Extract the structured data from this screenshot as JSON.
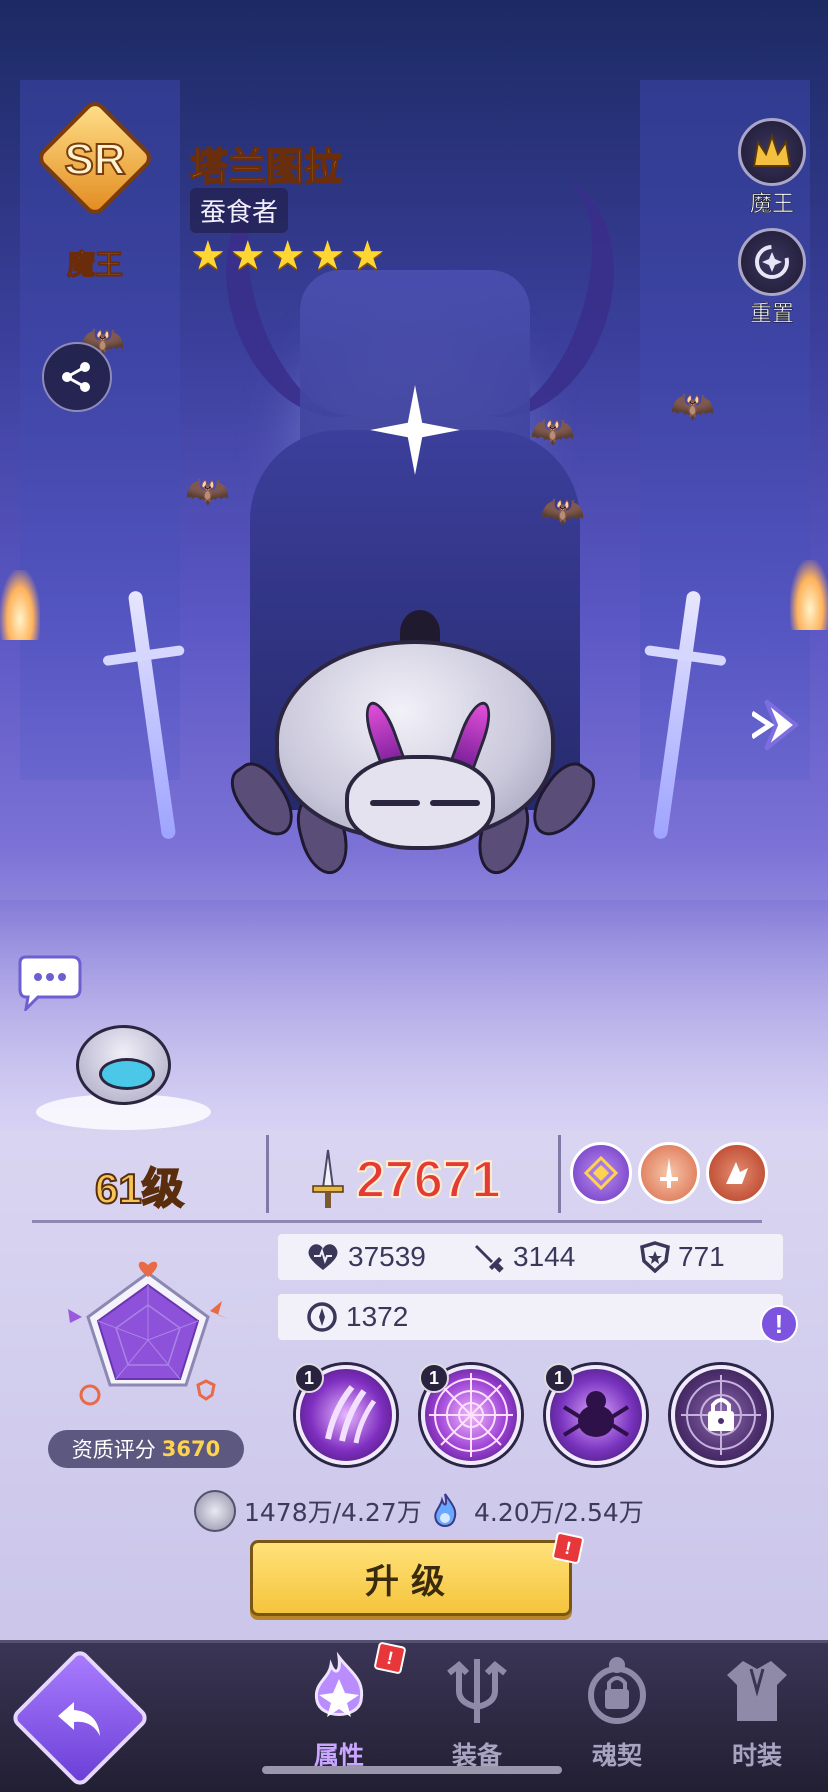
{
  "hero": {
    "rarity": "SR",
    "role": "魔王",
    "name": "塔兰图拉",
    "title": "蚕食者",
    "stars": 5
  },
  "side_buttons": [
    {
      "label": "魔王",
      "icon": "demon-king-crest-icon"
    },
    {
      "label": "重置",
      "icon": "reset-icon"
    }
  ],
  "stats": {
    "level": "61级",
    "power": "27671",
    "hp": "37539",
    "attack": "3144",
    "defense": "771",
    "speed": "1372",
    "quality_label": "资质评分",
    "quality_value": "3670"
  },
  "elements": [
    {
      "icon": "element-diamond-icon",
      "color": "#7a3fd0"
    },
    {
      "icon": "sword-emblem-icon",
      "color": "#d86a4a"
    },
    {
      "icon": "shatter-emblem-icon",
      "color": "#c0492f"
    }
  ],
  "skills": [
    {
      "level": "1",
      "icon": "claw-skill-icon",
      "locked": false
    },
    {
      "level": "1",
      "icon": "web-skill-icon",
      "locked": false
    },
    {
      "level": "1",
      "icon": "spider-skill-icon",
      "locked": false
    },
    {
      "level": "",
      "icon": "locked-web-skill-icon",
      "locked": true
    }
  ],
  "costs": [
    {
      "value": "1478万/4.27万",
      "icon": "coin-icon"
    },
    {
      "value": "4.20万/2.54万",
      "icon": "soul-flame-icon"
    }
  ],
  "upgrade_label": "升级",
  "nav": [
    {
      "label": "属性",
      "icon": "attributes-icon",
      "active": true,
      "alert": true
    },
    {
      "label": "装备",
      "icon": "equipment-icon",
      "active": false,
      "alert": false
    },
    {
      "label": "魂契",
      "icon": "soul-pact-icon",
      "active": false,
      "alert": false
    },
    {
      "label": "时装",
      "icon": "costume-icon",
      "active": false,
      "alert": false
    }
  ],
  "colors": {
    "accent_gold": "#ffd966",
    "power_red": "#e43a3a",
    "active_tab": "#c9a6ff"
  }
}
